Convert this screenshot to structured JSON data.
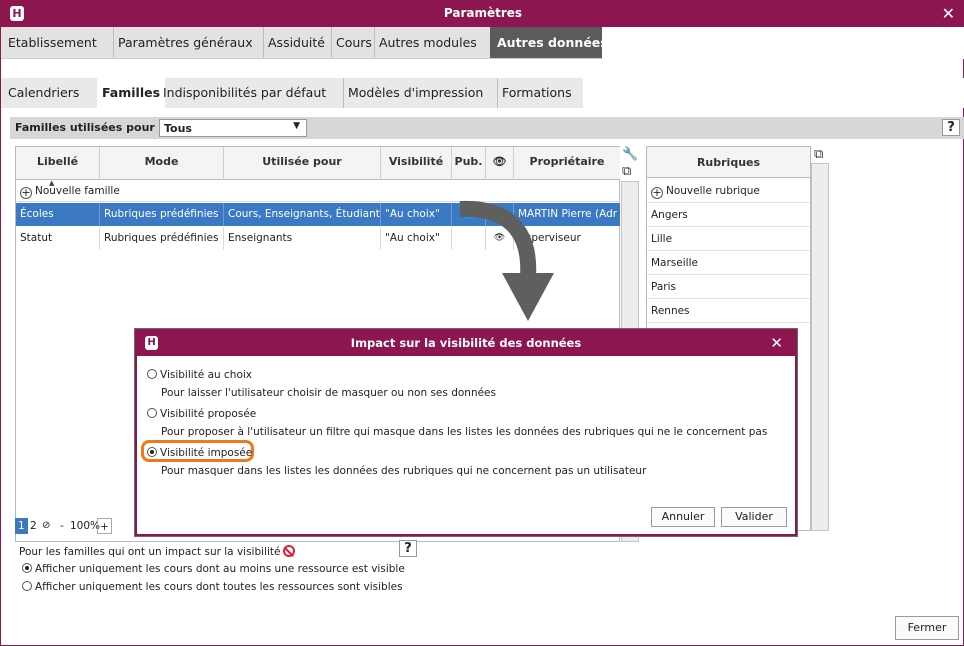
{
  "window": {
    "title": "Paramètres",
    "logo": "H"
  },
  "tabs_main": [
    {
      "label": "Etablissement"
    },
    {
      "label": "Paramètres généraux"
    },
    {
      "label": "Assiduité"
    },
    {
      "label": "Cours"
    },
    {
      "label": "Autres modules"
    },
    {
      "label": "Autres données",
      "active": true
    }
  ],
  "tabs_sub": [
    {
      "label": "Calendriers"
    },
    {
      "label": "Familles",
      "active": true
    },
    {
      "label": "Indisponibilités par défaut"
    },
    {
      "label": "Modèles d'impression"
    },
    {
      "label": "Formations"
    }
  ],
  "filter": {
    "label": "Familles utilisées pour",
    "value": "Tous",
    "help": "?"
  },
  "grid": {
    "columns": [
      "Libellé",
      "Mode",
      "Utilisée pour",
      "Visibilité",
      "Pub.",
      "Propriétaire"
    ],
    "new_label": "Nouvelle famille",
    "rows": [
      {
        "libelle": "Écoles",
        "mode": "Rubriques prédéfinies",
        "utilisee": "Cours, Enseignants, Étudiants",
        "visibilite": "\"Au choix\"",
        "proprietaire": "MARTIN Pierre (Adr",
        "selected": true
      },
      {
        "libelle": "Statut",
        "mode": "Rubriques prédéfinies",
        "utilisee": "Enseignants",
        "visibilite": "\"Au choix\"",
        "proprietaire": "Superviseur",
        "selected": false
      }
    ]
  },
  "rubriques": {
    "header": "Rubriques",
    "new_label": "Nouvelle rubrique",
    "items": [
      "Angers",
      "Lille",
      "Marseille",
      "Paris",
      "Rennes"
    ]
  },
  "pager": {
    "page1": "1",
    "page2": "2",
    "zoom": "100%",
    "minus": "-",
    "plus": "+"
  },
  "bottom": {
    "impact_label": "Pour les familles qui ont un impact sur la visibilité",
    "help": "?",
    "option1": "Afficher uniquement les cours dont au moins une ressource est visible",
    "option2": "Afficher uniquement les cours dont toutes les ressources sont visibles",
    "close_button": "Fermer"
  },
  "dialog": {
    "title": "Impact sur la visibilité des données",
    "options": [
      {
        "label": "Visibilité au choix",
        "desc": "Pour laisser l'utilisateur choisir de masquer ou non ses données",
        "selected": false
      },
      {
        "label": "Visibilité proposée",
        "desc": "Pour proposer à l'utilisateur un filtre qui masque dans les listes les données des rubriques qui ne le concernent pas",
        "selected": false
      },
      {
        "label": "Visibilité imposée",
        "desc": "Pour masquer dans les listes les données des rubriques  qui ne concernent pas un utilisateur",
        "selected": true
      }
    ],
    "cancel": "Annuler",
    "ok": "Valider"
  },
  "colors": {
    "brand": "#8d1550",
    "selection": "#3c79c4",
    "highlight": "#ef7a1a"
  }
}
